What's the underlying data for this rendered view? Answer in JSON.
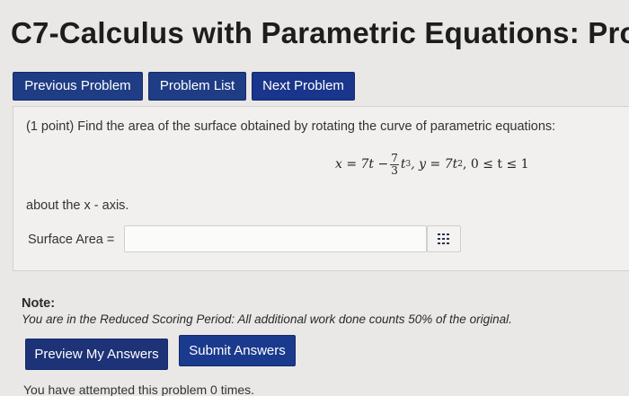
{
  "page": {
    "title": "C7-Calculus with Parametric Equations: Pro"
  },
  "nav": {
    "previous": "Previous Problem",
    "list": "Problem List",
    "next": "Next Problem"
  },
  "problem": {
    "prompt": "(1 point) Find the area of the surface obtained by rotating the curve of parametric equations:",
    "equation": {
      "x_lhs": "x = 7t −",
      "frac_num": "7",
      "frac_den": "3",
      "x_tail": "t",
      "x_exp": "3",
      "y_part": ", y = 7t",
      "y_exp": "2",
      "range": ", 0 ≤ t ≤ 1"
    },
    "about": "about the x - axis.",
    "answer_label": "Surface Area =",
    "answer_value": ""
  },
  "note": {
    "heading": "Note:",
    "body": "You are in the Reduced Scoring Period: All additional work done counts 50% of the original."
  },
  "actions": {
    "preview": "Preview My Answers",
    "submit": "Submit Answers"
  },
  "attempts": "You have attempted this problem 0 times."
}
